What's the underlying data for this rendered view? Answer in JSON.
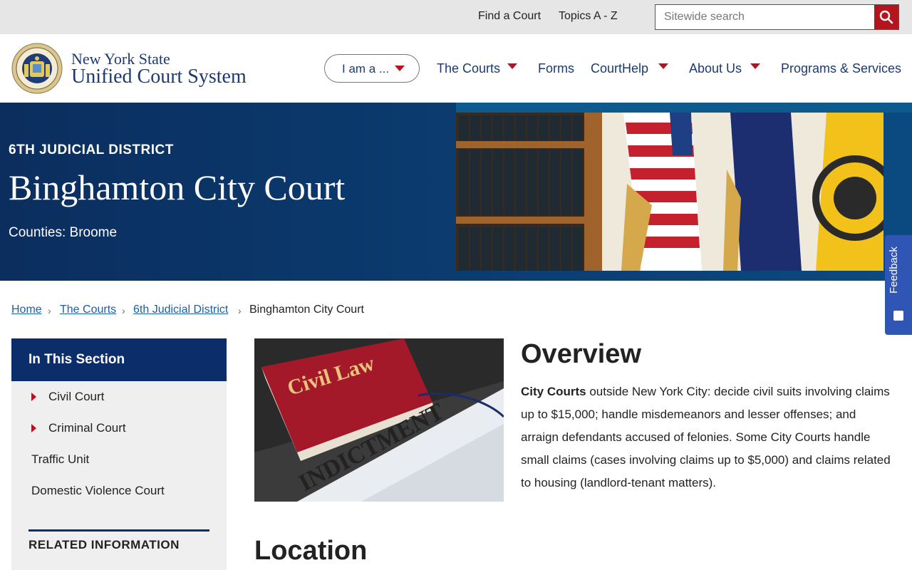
{
  "utility": {
    "find_court": "Find a Court",
    "topics": "Topics A - Z",
    "search_placeholder": "Sitewide search"
  },
  "brand": {
    "line1": "New York State",
    "line2": "Unified Court System"
  },
  "nav": {
    "iam": "I am a ...",
    "courts": "The Courts",
    "forms": "Forms",
    "courthelp": "CourtHelp",
    "about": "About Us",
    "programs": "Programs & Services"
  },
  "hero": {
    "district": "6TH JUDICIAL DISTRICT",
    "title": "Binghamton City Court",
    "counties": "Counties: Broome"
  },
  "feedback": {
    "label": "Feedback"
  },
  "breadcrumb": {
    "home": "Home",
    "courts": "The Courts",
    "district": "6th Judicial District",
    "current": "Binghamton City Court"
  },
  "sidebar": {
    "heading": "In This Section",
    "items": [
      {
        "label": "Civil Court"
      },
      {
        "label": "Criminal Court"
      },
      {
        "label": "Traffic Unit"
      },
      {
        "label": "Domestic Violence Court"
      }
    ],
    "related_heading": "RELATED INFORMATION"
  },
  "image_text": {
    "book": "Civil Law",
    "paper": "INDICTMENT"
  },
  "overview": {
    "heading": "Overview",
    "lead": "City Courts",
    "body": " outside New York City: decide civil suits involving claims up to $15,000; handle misdemeanors and lesser offenses; and arraign defendants accused of felonies. Some City Courts handle small claims (cases involving claims up to $5,000) and claims related to housing (landlord-tenant matters)."
  },
  "location": {
    "heading": "Location"
  },
  "colors": {
    "navy": "#0b2e6b",
    "link_blue": "#1b5ea8",
    "accent_red": "#b4141e",
    "feedback_blue": "#2f55b5"
  }
}
